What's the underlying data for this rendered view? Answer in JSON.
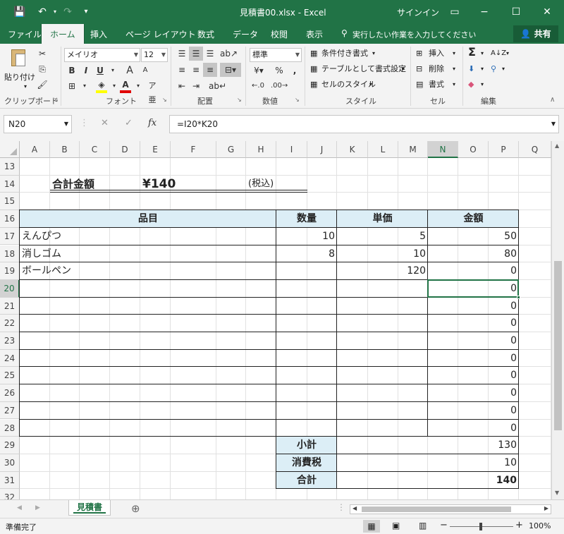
{
  "window": {
    "title": "見積書00.xlsx  -  Excel",
    "signin": "サインイン",
    "minimize": "−",
    "restore": "☐",
    "close": "✕",
    "restore_ribbon": "▭"
  },
  "quick_access": {
    "save": "💾",
    "undo": "↶",
    "redo": "↷",
    "customize": "▾"
  },
  "tabs": [
    "ファイル",
    "ホーム",
    "挿入",
    "ページ レイアウト",
    "数式",
    "データ",
    "校閲",
    "表示"
  ],
  "tell_me": "実行したい作業を入力してください",
  "share": "共有",
  "ribbon": {
    "clipboard": {
      "paste": "貼り付け",
      "label": "クリップボード"
    },
    "font": {
      "name": "メイリオ",
      "size": "12",
      "grow": "A",
      "shrink": "A",
      "bold": "B",
      "italic": "I",
      "underline": "U",
      "label": "フォント",
      "font_color": "#e00000",
      "fill_color": "#ffff00"
    },
    "alignment": {
      "label": "配置"
    },
    "number": {
      "format": "標準",
      "percent": "%",
      "comma": ",",
      "label": "数値"
    },
    "styles": {
      "conditional": "条件付き書式",
      "table": "テーブルとして書式設定",
      "cell": "セルのスタイル",
      "label": "スタイル"
    },
    "cells": {
      "insert": "挿入",
      "delete": "削除",
      "format": "書式",
      "label": "セル"
    },
    "editing": {
      "sum": "Σ",
      "sort": "A↓Z",
      "find": "⚲",
      "label": "編集"
    }
  },
  "formula_bar": {
    "name_box": "N20",
    "cancel": "✕",
    "enter": "✓",
    "fx": "fx",
    "formula": "=I20*K20"
  },
  "columns": [
    "A",
    "B",
    "C",
    "D",
    "E",
    "F",
    "G",
    "H",
    "I",
    "J",
    "K",
    "L",
    "M",
    "N",
    "O",
    "P",
    "Q"
  ],
  "selected_column": "N",
  "rows": [
    "13",
    "14",
    "15",
    "16",
    "17",
    "18",
    "19",
    "20",
    "21",
    "22",
    "23",
    "24",
    "25",
    "26",
    "27",
    "28",
    "29",
    "30",
    "31",
    "32"
  ],
  "selected_row": "20",
  "sheet": {
    "total_label": "合計金額",
    "total_value": "¥140",
    "tax_note": "(税込)",
    "headers": {
      "item": "品目",
      "qty": "数量",
      "unit": "単価",
      "amount": "金額"
    },
    "items": [
      {
        "item": "えんぴつ",
        "qty": "10",
        "unit": "5",
        "amount": "50"
      },
      {
        "item": "消しゴム",
        "qty": "8",
        "unit": "10",
        "amount": "80"
      },
      {
        "item": "ボールペン",
        "qty": "",
        "unit": "120",
        "amount": "0"
      },
      {
        "item": "",
        "qty": "",
        "unit": "",
        "amount": "0"
      },
      {
        "item": "",
        "qty": "",
        "unit": "",
        "amount": "0"
      },
      {
        "item": "",
        "qty": "",
        "unit": "",
        "amount": "0"
      },
      {
        "item": "",
        "qty": "",
        "unit": "",
        "amount": "0"
      },
      {
        "item": "",
        "qty": "",
        "unit": "",
        "amount": "0"
      },
      {
        "item": "",
        "qty": "",
        "unit": "",
        "amount": "0"
      },
      {
        "item": "",
        "qty": "",
        "unit": "",
        "amount": "0"
      },
      {
        "item": "",
        "qty": "",
        "unit": "",
        "amount": "0"
      },
      {
        "item": "",
        "qty": "",
        "unit": "",
        "amount": "0"
      }
    ],
    "summary": [
      {
        "label": "小計",
        "value": "130"
      },
      {
        "label": "消費税",
        "value": "10"
      },
      {
        "label": "合計",
        "value": "140"
      }
    ]
  },
  "sheet_tabs": {
    "active": "見積書",
    "add": "⊕",
    "prev": "◀",
    "next": "▶"
  },
  "status": {
    "ready": "準備完了",
    "zoom": "100%",
    "minus": "−",
    "plus": "+"
  },
  "colors": {
    "excel_green": "#217346",
    "header_fill": "#dceef6"
  }
}
